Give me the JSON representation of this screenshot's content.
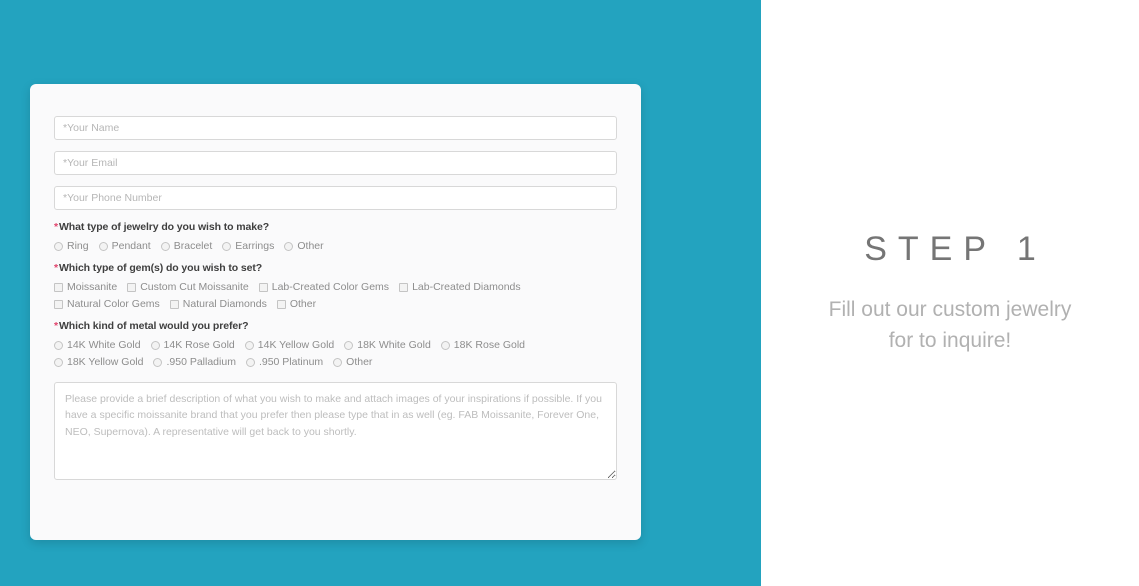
{
  "background": {
    "teal": "#23a3bf",
    "panel": "#ffffff",
    "card": "#fafafb",
    "accent_required": "#e0436c"
  },
  "form": {
    "fields": [
      {
        "name": "name",
        "placeholder": "*Your Name",
        "value": ""
      },
      {
        "name": "email",
        "placeholder": "*Your Email",
        "value": ""
      },
      {
        "name": "phone",
        "placeholder": "*Your Phone Number",
        "value": ""
      }
    ],
    "questions": [
      {
        "id": "jewelry-type",
        "required_marker": "*",
        "label": "What type of jewelry do you wish to make?",
        "input_type": "radio",
        "rows": [
          [
            "Ring",
            "Pendant",
            "Bracelet",
            "Earrings",
            "Other"
          ]
        ]
      },
      {
        "id": "gem-type",
        "required_marker": "*",
        "label": "Which type of gem(s) do you wish to set?",
        "input_type": "checkbox",
        "rows": [
          [
            "Moissanite",
            "Custom Cut Moissanite",
            "Lab-Created Color Gems",
            "Lab-Created Diamonds"
          ],
          [
            "Natural Color Gems",
            "Natural Diamonds",
            "Other"
          ]
        ]
      },
      {
        "id": "metal-type",
        "required_marker": "*",
        "label": "Which kind of metal would you prefer?",
        "input_type": "radio",
        "rows": [
          [
            "14K White Gold",
            "14K Rose Gold",
            "14K Yellow Gold",
            "18K White Gold",
            "18K Rose Gold"
          ],
          [
            "18K Yellow Gold",
            ".950 Palladium",
            ".950 Platinum",
            "Other"
          ]
        ]
      }
    ],
    "description": {
      "placeholder": "Please provide a brief description of what you wish to make and attach images of your inspirations if possible. If you have a specific moissanite brand that you prefer then please type that in as well (eg. FAB Moissanite, Forever One, NEO, Supernova). A representative will get back to you shortly.",
      "value": ""
    }
  },
  "step_panel": {
    "title": "STEP 1",
    "subtitle": "Fill out our custom jewelry for to inquire!"
  }
}
